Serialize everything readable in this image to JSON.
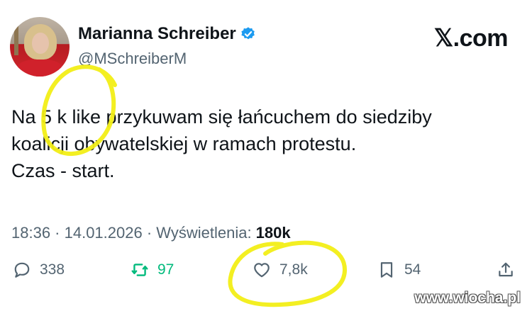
{
  "author": {
    "name": "Marianna Schreiber",
    "handle": "@MSchreiberM"
  },
  "brand": "𝕏.com",
  "tweet": {
    "lines": [
      "Na 5 k like przykuwam się łańcuchem do siedziby",
      "koalicji obywatelskiej w ramach protestu.",
      "Czas - start."
    ]
  },
  "meta": {
    "time_date": "18:36 · 14.01.2026 · ",
    "views_label": "Wyświetlenia: ",
    "views_value": "180k"
  },
  "actions": {
    "replies": "338",
    "reposts": "97",
    "likes": "7,8k",
    "bookmarks": "54"
  },
  "icons": {
    "reply": "reply-icon",
    "repost": "repost-icon",
    "like": "heart-icon",
    "bookmark": "bookmark-icon",
    "share": "share-icon",
    "verified": "verified-badge-icon"
  },
  "colors": {
    "highlight": "#f2ee16",
    "repost_green": "#00ba7c",
    "verified_blue": "#1d9bf0",
    "muted": "#536471"
  },
  "watermark": "www.wiocha.pl"
}
